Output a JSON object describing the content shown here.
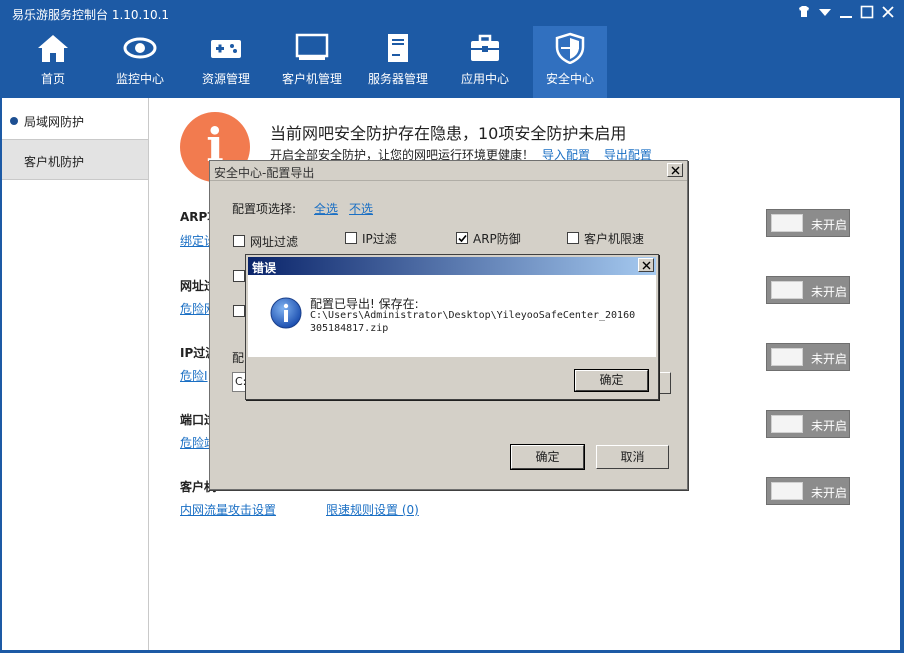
{
  "app": {
    "title": "易乐游服务控制台 1.10.10.1"
  },
  "nav": {
    "items": [
      {
        "label": "首页",
        "icon": "home-icon"
      },
      {
        "label": "监控中心",
        "icon": "eye-icon"
      },
      {
        "label": "资源管理",
        "icon": "gamepad-icon"
      },
      {
        "label": "客户机管理",
        "icon": "monitor-icon"
      },
      {
        "label": "服务器管理",
        "icon": "server-icon"
      },
      {
        "label": "应用中心",
        "icon": "toolbox-icon"
      },
      {
        "label": "安全中心",
        "icon": "shield-icon"
      }
    ],
    "active_index": 6
  },
  "sidebar": {
    "items": [
      {
        "label": "局域网防护"
      },
      {
        "label": "客户机防护"
      }
    ]
  },
  "content": {
    "info_glyph": "i",
    "headline": "当前网吧安全防护存在隐患，10项安全防护未启用",
    "subline": "开启全部安全防护，让您的网吧运行环境更健康！",
    "import_link": "导入配置",
    "export_link": "导出配置",
    "sections": [
      {
        "title": "ARP攻",
        "link": "绑定设",
        "toggle": "未开启"
      },
      {
        "title": "网址过",
        "link": "危险网",
        "toggle": "未开启"
      },
      {
        "title": "IP过滤",
        "link": "危险I",
        "toggle": "未开启"
      },
      {
        "title": "端口过",
        "link": "危险端",
        "toggle": "未开启"
      },
      {
        "title": "客户机",
        "link": "内网流量攻击设置",
        "link2": "限速规则设置 (0)",
        "toggle": "未开启"
      }
    ]
  },
  "config_dialog": {
    "title": "安全中心-配置导出",
    "select_label": "配置项选择:",
    "select_all": "全选",
    "select_none": "不选",
    "options": [
      {
        "label": "网址过滤",
        "checked": false
      },
      {
        "label": "IP过滤",
        "checked": false
      },
      {
        "label": "ARP防御",
        "checked": true
      },
      {
        "label": "客户机限速",
        "checked": false
      }
    ],
    "partial_label": "配",
    "path_partial": "C:",
    "ok": "确定",
    "cancel": "取消"
  },
  "error_dialog": {
    "title": "错误",
    "message": "配置已导出! 保存在:",
    "path": "C:\\Users\\Administrator\\Desktop\\YileyooSafeCenter_20160305184817.zip",
    "ok": "确定"
  },
  "colors": {
    "brand": "#1d5aa5",
    "active_tab": "#3170bf",
    "accent_orange": "#f27b4f",
    "link": "#1a6fc4",
    "toggle_off": "#8c8c8c"
  }
}
